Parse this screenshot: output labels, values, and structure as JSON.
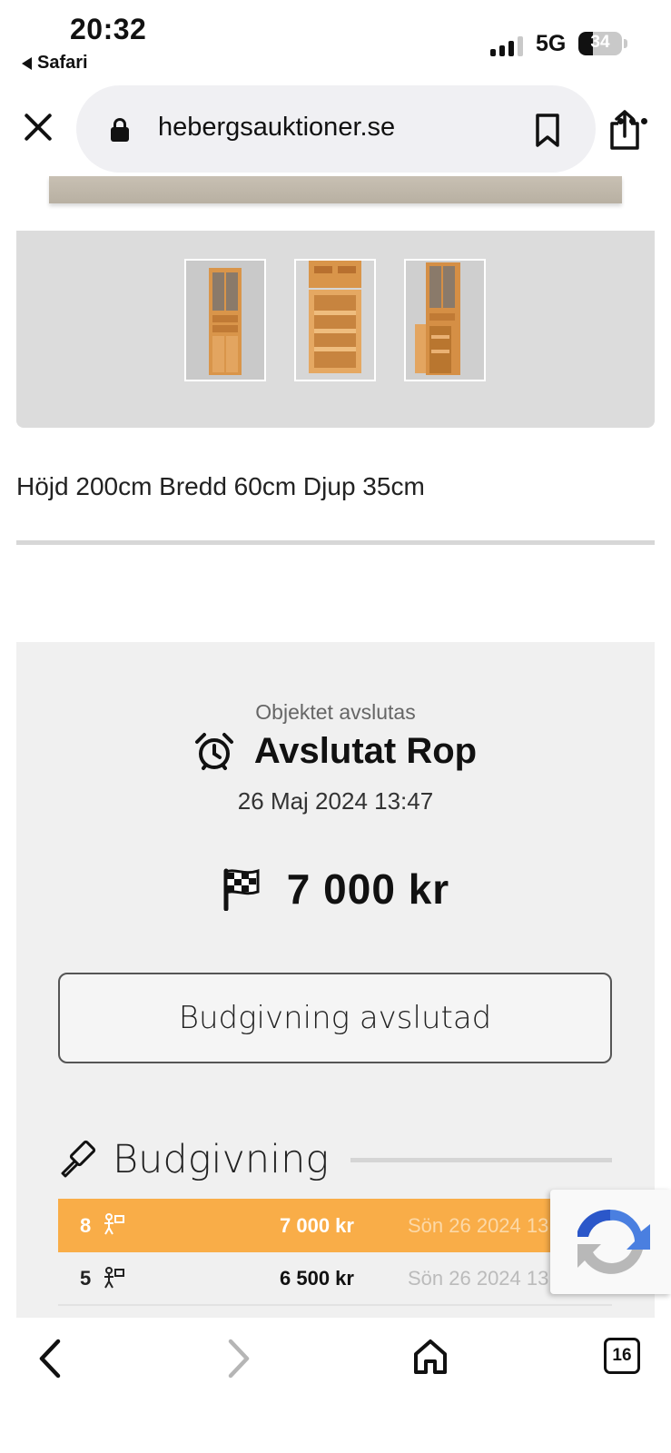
{
  "status_bar": {
    "time": "20:32",
    "back_app": "Safari",
    "network": "5G",
    "battery": "34",
    "battery_level": 0.34
  },
  "browser": {
    "url": "hebergsauktioner.se",
    "icons": [
      "close-icon",
      "lock-icon",
      "bookmark-icon",
      "share-icon",
      "more-icon"
    ]
  },
  "product": {
    "dimensions": "Höjd 200cm Bredd 60cm Djup 35cm"
  },
  "auction": {
    "ends_label": "Objektet avslutas",
    "status": "Avslutat Rop",
    "end_date": "26 Maj 2024 13:47",
    "final_price": "7 000 kr",
    "closed_button": "Budgivning avslutad",
    "bidding_title": "Budgivning",
    "bids": [
      {
        "bidder": "8",
        "amount": "7 000 kr",
        "date": "Sön 26 2024 13",
        "highlight": true
      },
      {
        "bidder": "5",
        "amount": "6 500 kr",
        "date": "Sön 26 2024 13",
        "highlight": false
      }
    ]
  },
  "toolbar": {
    "tabs_count": "16"
  },
  "colors": {
    "accent_orange": "#f9ad48",
    "panel_gray": "#f0f0f0",
    "url_bar_bg": "#f0f0f3"
  }
}
